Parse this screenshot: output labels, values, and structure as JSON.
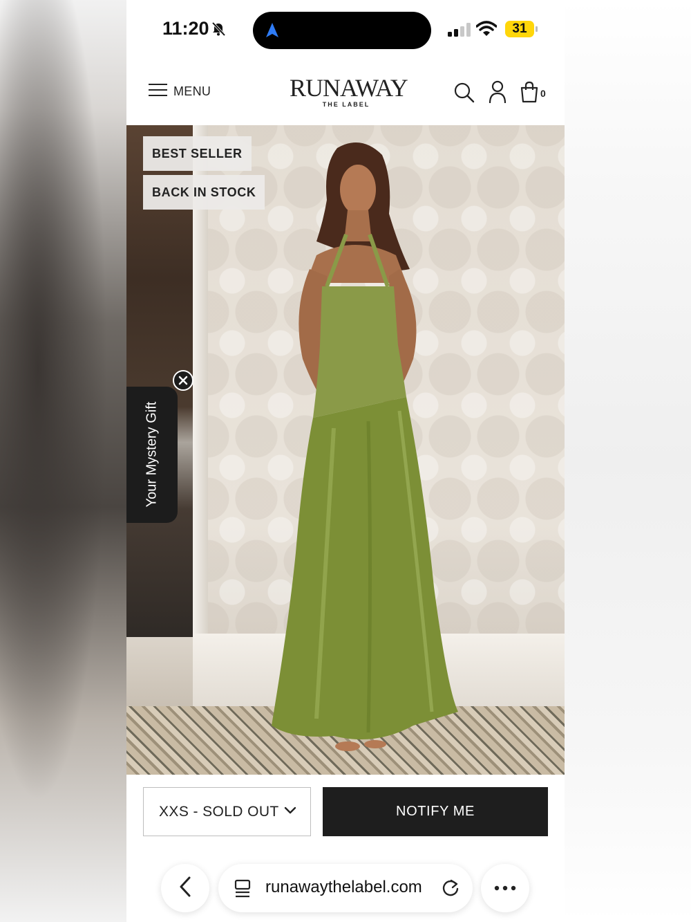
{
  "status_bar": {
    "time": "11:20",
    "battery_level": "31",
    "icons": [
      "bell-slash-icon",
      "navigation-arrow-icon",
      "signal-icon",
      "wifi-icon",
      "battery-icon"
    ]
  },
  "header": {
    "menu_label": "MENU",
    "logo_main": "RUNAWAY",
    "logo_sub": "THE LABEL",
    "cart_count": "0",
    "icons": [
      "hamburger-icon",
      "search-icon",
      "account-icon",
      "bag-icon"
    ]
  },
  "product": {
    "badges": [
      "BEST SELLER",
      "BACK IN STOCK"
    ],
    "dress_color": "#8a9a48"
  },
  "gift_tab": {
    "label": "Your Mystery Gift"
  },
  "purchase": {
    "size_value": "XXS - SOLD OUT",
    "notify_label": "NOTIFY ME"
  },
  "browser": {
    "url": "runawaythelabel.com"
  },
  "colors": {
    "button_dark": "#1e1e1e",
    "battery": "#ffd60a",
    "accent_blue": "#2f7cf6"
  }
}
